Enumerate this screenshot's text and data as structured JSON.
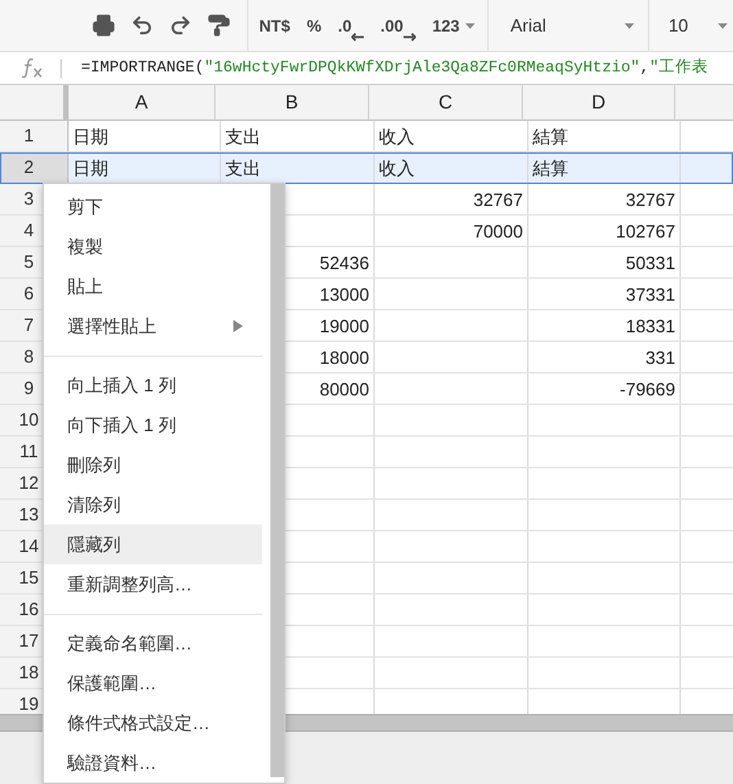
{
  "toolbar": {
    "format_buttons": [
      {
        "label": "NT$",
        "kind": "text"
      },
      {
        "label": "%",
        "kind": "text"
      },
      {
        "label": ".0",
        "kind": "decrease"
      },
      {
        "label": ".00",
        "kind": "increase"
      },
      {
        "label": "123",
        "kind": "dropdown"
      }
    ],
    "font": "Arial",
    "font_size": "10"
  },
  "formula_bar": {
    "segments": [
      {
        "text": "=IMPORTRANGE(",
        "kind": "plain"
      },
      {
        "text": "\"16wHctyFwrDPQkKWfXDrjAle3Qa8ZFc0RMeaqSyHtzio\"",
        "kind": "string"
      },
      {
        "text": ",",
        "kind": "plain"
      },
      {
        "text": "\"工作表",
        "kind": "string"
      }
    ]
  },
  "columns": [
    {
      "label": "A"
    },
    {
      "label": "B"
    },
    {
      "label": "C"
    },
    {
      "label": "D"
    }
  ],
  "rows": [
    {
      "number": "1",
      "selected": false,
      "kind": "text",
      "cells": {
        "A": "日期",
        "B": "支出",
        "C": "收入",
        "D": "結算"
      }
    },
    {
      "number": "2",
      "selected": true,
      "kind": "text",
      "cells": {
        "A": "日期",
        "B": "支出",
        "C": "收入",
        "D": "結算"
      }
    },
    {
      "number": "3",
      "selected": false,
      "kind": "number",
      "cells": {
        "C": "32767",
        "D": "32767"
      }
    },
    {
      "number": "4",
      "selected": false,
      "kind": "number",
      "cells": {
        "C": "70000",
        "D": "102767"
      }
    },
    {
      "number": "5",
      "selected": false,
      "kind": "number",
      "cells": {
        "B": "52436",
        "D": "50331"
      }
    },
    {
      "number": "6",
      "selected": false,
      "kind": "number",
      "cells": {
        "B": "13000",
        "D": "37331"
      }
    },
    {
      "number": "7",
      "selected": false,
      "kind": "number",
      "cells": {
        "B": "19000",
        "D": "18331"
      }
    },
    {
      "number": "8",
      "selected": false,
      "kind": "number",
      "cells": {
        "B": "18000",
        "D": "331"
      }
    },
    {
      "number": "9",
      "selected": false,
      "kind": "number",
      "cells": {
        "B": "80000",
        "D": "-79669"
      }
    },
    {
      "number": "10",
      "selected": false,
      "kind": "number"
    },
    {
      "number": "11",
      "selected": false,
      "kind": "number"
    },
    {
      "number": "12",
      "selected": false,
      "kind": "number"
    },
    {
      "number": "13",
      "selected": false,
      "kind": "number"
    },
    {
      "number": "14",
      "selected": false,
      "kind": "number"
    },
    {
      "number": "15",
      "selected": false,
      "kind": "number"
    },
    {
      "number": "16",
      "selected": false,
      "kind": "number"
    },
    {
      "number": "17",
      "selected": false,
      "kind": "number"
    },
    {
      "number": "18",
      "selected": false,
      "kind": "number"
    },
    {
      "number": "19",
      "selected": false,
      "kind": "number"
    }
  ],
  "context_menu": {
    "groups": [
      {
        "items": [
          {
            "label": "剪下",
            "highlighted": false,
            "has_submenu": false
          },
          {
            "label": "複製",
            "highlighted": false,
            "has_submenu": false
          },
          {
            "label": "貼上",
            "highlighted": false,
            "has_submenu": false
          },
          {
            "label": "選擇性貼上",
            "highlighted": false,
            "has_submenu": true
          }
        ]
      },
      {
        "items": [
          {
            "label": "向上插入 1 列",
            "highlighted": false,
            "has_submenu": false
          },
          {
            "label": "向下插入 1 列",
            "highlighted": false,
            "has_submenu": false
          },
          {
            "label": "刪除列",
            "highlighted": false,
            "has_submenu": false
          },
          {
            "label": "清除列",
            "highlighted": false,
            "has_submenu": false
          },
          {
            "label": "隱藏列",
            "highlighted": true,
            "has_submenu": false
          },
          {
            "label": "重新調整列高…",
            "highlighted": false,
            "has_submenu": false
          }
        ]
      },
      {
        "items": [
          {
            "label": "定義命名範圍…",
            "highlighted": false,
            "has_submenu": false
          },
          {
            "label": "保護範圍…",
            "highlighted": false,
            "has_submenu": false
          },
          {
            "label": "條件式格式設定…",
            "highlighted": false,
            "has_submenu": false
          },
          {
            "label": "驗證資料…",
            "highlighted": false,
            "has_submenu": false
          }
        ]
      }
    ]
  }
}
